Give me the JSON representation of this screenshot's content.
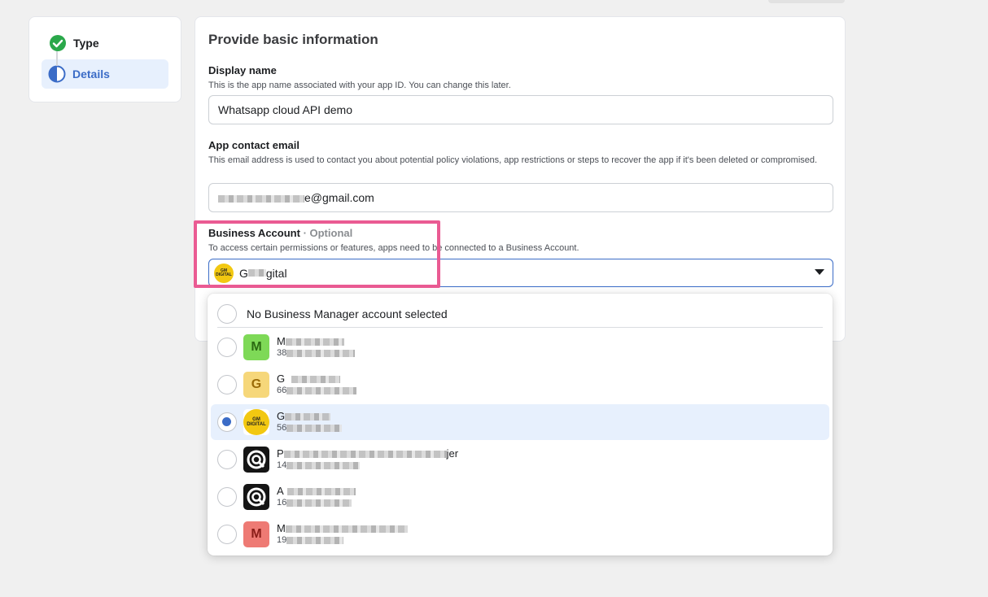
{
  "stepper": {
    "steps": [
      {
        "label": "Type",
        "state": "done"
      },
      {
        "label": "Details",
        "state": "active"
      }
    ]
  },
  "form": {
    "title": "Provide basic information",
    "display_name": {
      "label": "Display name",
      "help": "This is the app name associated with your app ID. You can change this later.",
      "value": "Whatsapp cloud API demo"
    },
    "email": {
      "label": "App contact email",
      "help": "This email address is used to contact you about potential policy violations, app restrictions or steps to recover the app if it's been deleted or compromised.",
      "value_suffix": "e@gmail.com"
    },
    "business_account": {
      "label": "Business Account",
      "optional": "· Optional",
      "help": "To access certain permissions or features, apps need to be connected to a Business Account.",
      "selected_prefix": "G",
      "selected_suffix": "gital",
      "logo_text_top": "GM",
      "logo_text_bottom": "DIGITAL"
    }
  },
  "dropdown": {
    "none_label": "No Business Manager account selected",
    "items": [
      {
        "initial": "M",
        "name_prefix": "M",
        "sub_prefix": "38",
        "avatar": "green",
        "selected": false
      },
      {
        "initial": "G",
        "name_prefix": "G",
        "sub_prefix": "66",
        "avatar": "yellow",
        "selected": false
      },
      {
        "initial": "",
        "name_prefix": "G",
        "sub_prefix": "56",
        "avatar": "gm",
        "selected": true
      },
      {
        "initial": "",
        "name_prefix": "P",
        "name_suffix": "jer",
        "sub_prefix": "14",
        "avatar": "dark",
        "selected": false
      },
      {
        "initial": "",
        "name_prefix": "A",
        "sub_prefix": "16",
        "avatar": "dark",
        "selected": false
      },
      {
        "initial": "M",
        "name_prefix": "M",
        "sub_prefix": "19",
        "avatar": "red",
        "selected": false
      }
    ]
  },
  "colors": {
    "accent": "#3b6cc7",
    "success": "#2aa84a",
    "highlight": "#ea5b93"
  }
}
